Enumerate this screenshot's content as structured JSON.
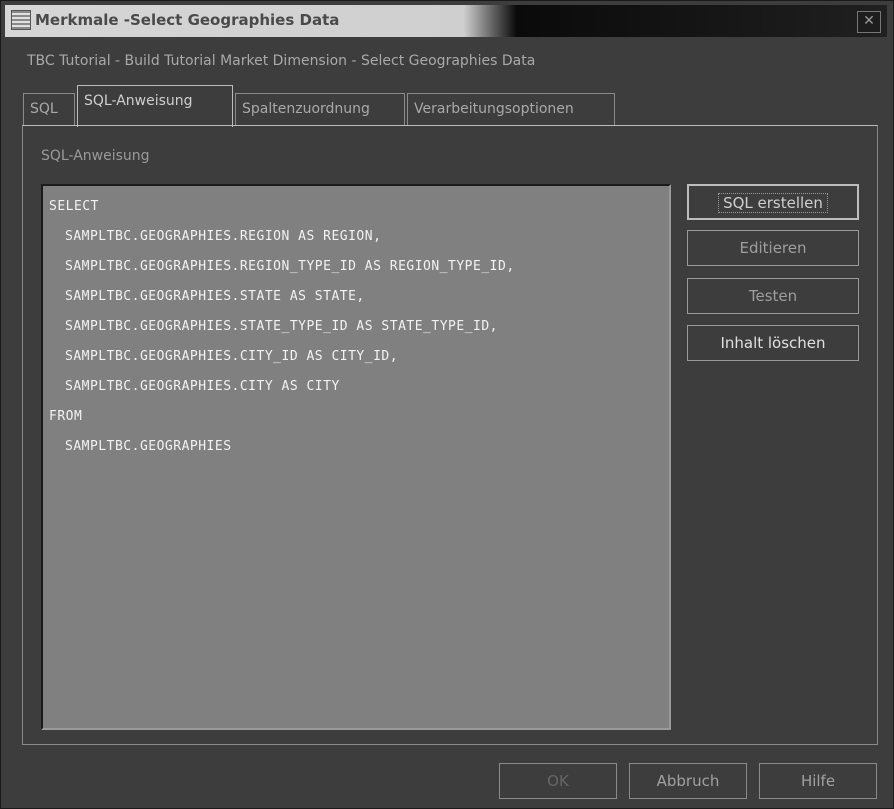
{
  "window": {
    "title": "Merkmale -Select Geographies Data",
    "close_glyph": "✕"
  },
  "subtitle": "TBC Tutorial - Build Tutorial Market Dimension - Select Geographies Data",
  "tabs": [
    {
      "label": "SQL",
      "active": false
    },
    {
      "label": "SQL-Anweisung",
      "active": true
    },
    {
      "label": "Spaltenzuordnung",
      "active": false
    },
    {
      "label": "Verarbeitungsoptionen",
      "active": false
    }
  ],
  "panel": {
    "label": "SQL-Anweisung",
    "sql_lines": [
      {
        "text": "SELECT",
        "indent": false
      },
      {
        "text": "SAMPLTBC.GEOGRAPHIES.REGION AS REGION,",
        "indent": true
      },
      {
        "text": "SAMPLTBC.GEOGRAPHIES.REGION_TYPE_ID AS REGION_TYPE_ID,",
        "indent": true
      },
      {
        "text": "SAMPLTBC.GEOGRAPHIES.STATE AS STATE,",
        "indent": true
      },
      {
        "text": "SAMPLTBC.GEOGRAPHIES.STATE_TYPE_ID AS STATE_TYPE_ID,",
        "indent": true
      },
      {
        "text": "SAMPLTBC.GEOGRAPHIES.CITY_ID AS CITY_ID,",
        "indent": true
      },
      {
        "text": "SAMPLTBC.GEOGRAPHIES.CITY AS CITY",
        "indent": true
      },
      {
        "text": "FROM",
        "indent": false
      },
      {
        "text": "SAMPLTBC.GEOGRAPHIES",
        "indent": true
      }
    ],
    "buttons": {
      "build_sql": "SQL erstellen",
      "edit": "Editieren",
      "test": "Testen",
      "clear": "Inhalt löschen"
    }
  },
  "footer": {
    "ok": "OK",
    "cancel": "Abbruch",
    "help": "Hilfe"
  }
}
